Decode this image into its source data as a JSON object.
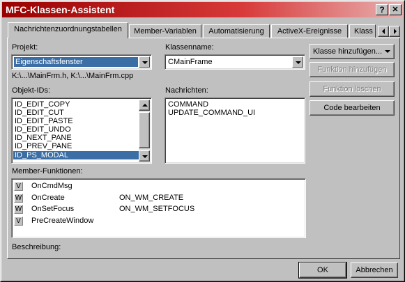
{
  "window": {
    "title": "MFC-Klassen-Assistent",
    "help_glyph": "?",
    "close_glyph": "✕"
  },
  "tabs": [
    {
      "label": "Nachrichtenzuordnungstabellen",
      "active": true
    },
    {
      "label": "Member-Variablen"
    },
    {
      "label": "Automatisierung"
    },
    {
      "label": "ActiveX-Ereignisse"
    },
    {
      "label": "Klass"
    }
  ],
  "project": {
    "label": "Projekt:",
    "value": "Eigenschaftsfenster"
  },
  "class_name": {
    "label": "Klassenname:",
    "value": "CMainFrame"
  },
  "files": "K:\\...\\MainFrm.h, K:\\...\\MainFrm.cpp",
  "object_ids": {
    "label": "Objekt-IDs:",
    "items": [
      "ID_EDIT_COPY",
      "ID_EDIT_CUT",
      "ID_EDIT_PASTE",
      "ID_EDIT_UNDO",
      "ID_NEXT_PANE",
      "ID_PREV_PANE",
      "ID_PS_MODAL"
    ],
    "selected_index": 6
  },
  "messages": {
    "label": "Nachrichten:",
    "items": [
      "COMMAND",
      "UPDATE_COMMAND_UI"
    ]
  },
  "member_functions": {
    "label": "Member-Funktionen:",
    "rows": [
      {
        "mark": "V",
        "name": "OnCmdMsg",
        "handler": ""
      },
      {
        "mark": "W",
        "name": "OnCreate",
        "handler": "ON_WM_CREATE"
      },
      {
        "mark": "W",
        "name": "OnSetFocus",
        "handler": "ON_WM_SETFOCUS"
      },
      {
        "mark": "V",
        "name": "PreCreateWindow",
        "handler": ""
      }
    ]
  },
  "description_label": "Beschreibung:",
  "buttons": {
    "add_class": "Klasse hinzufügen...",
    "add_function": "Funktion hinzufügen",
    "delete_function": "Funktion löschen",
    "edit_code": "Code bearbeiten",
    "ok": "OK",
    "cancel": "Abbrechen"
  },
  "colors": {
    "selection": "#3a6ea5",
    "title_start": "#9a0000",
    "title_end": "#e8b0b0",
    "face": "#c0c0c0"
  }
}
